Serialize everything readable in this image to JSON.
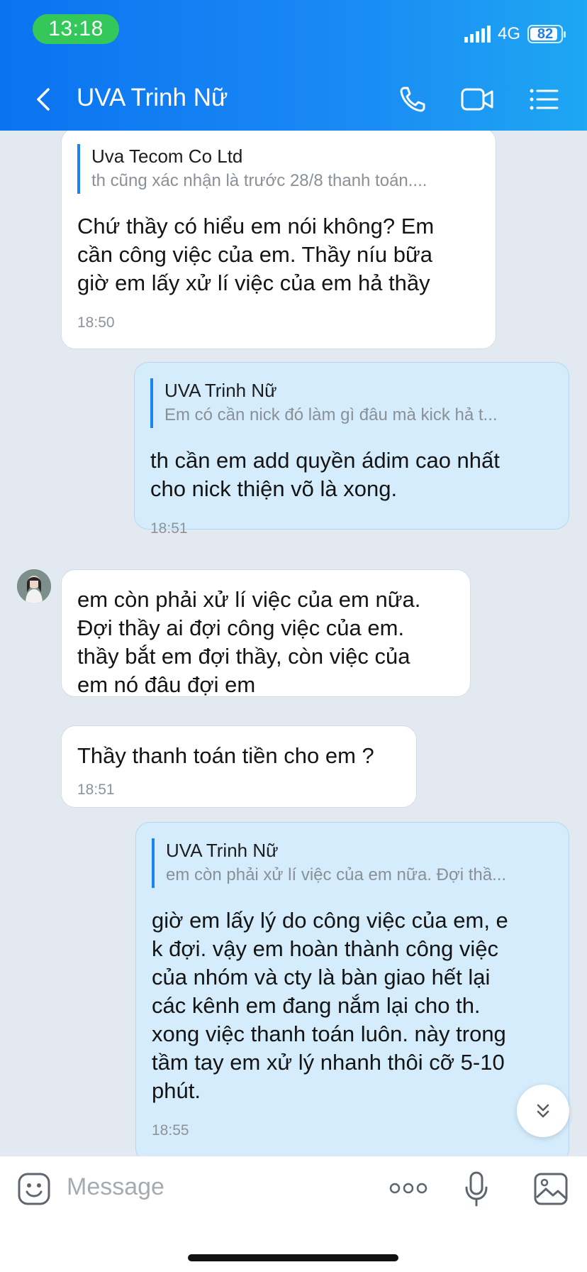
{
  "status_bar": {
    "time": "13:18",
    "network": "4G",
    "battery": "82"
  },
  "header": {
    "title": "UVA Trinh Nữ"
  },
  "messages": [
    {
      "quote_name": "Uva Tecom Co Ltd",
      "quote_text": "th cũng xác nhận là trước 28/8 thanh toán....",
      "text": "Chứ thầy có hiểu em nói không? Em\ncần công việc của em. Thầy níu bữa\ngiờ em lấy xử lí việc của em hả thầy",
      "time": "18:50"
    },
    {
      "quote_name": "UVA Trinh Nữ",
      "quote_text": "Em có cần nick đó làm gì đâu mà kick hả  t...",
      "text": "th cần em add quyền ádim cao nhất\ncho nick thiện võ là xong.",
      "time": "18:51"
    },
    {
      "text": "em còn phải xử lí việc của em nữa.\nĐợi thầy ai đợi công việc của em.\n thầy bắt em đợi thầy, còn việc của\nem nó đâu đợi em"
    },
    {
      "text": "Thầy thanh toán tiền cho em ?",
      "time": "18:51"
    },
    {
      "quote_name": "UVA Trinh Nữ",
      "quote_text": "em còn phải xử lí việc của em nữa. Đợi thầ...",
      "text": "giờ em lấy lý do công việc của em, e\nk đợi. vậy em hoàn thành công việc\ncủa nhóm và cty là bàn giao hết lại\ncác kênh em đang nắm lại cho th.\nxong việc thanh toán luôn. này trong\ntầm tay em xử lý nhanh thôi cỡ 5-10\nphút.",
      "time": "18:55"
    }
  ],
  "composer": {
    "placeholder": "Message"
  },
  "colors": {
    "header_start": "#0a73f0",
    "header_end": "#1ea7f2",
    "sent_bubble": "#d4ecfb",
    "received_bubble": "#ffffff",
    "chat_bg": "#e2e9f1",
    "quote_bar": "#1a85f2"
  },
  "icons": [
    "back-chevron-icon",
    "phone-icon",
    "video-call-icon",
    "menu-list-icon",
    "sticker-icon",
    "more-icon",
    "microphone-icon",
    "image-icon",
    "scroll-down-icon"
  ]
}
